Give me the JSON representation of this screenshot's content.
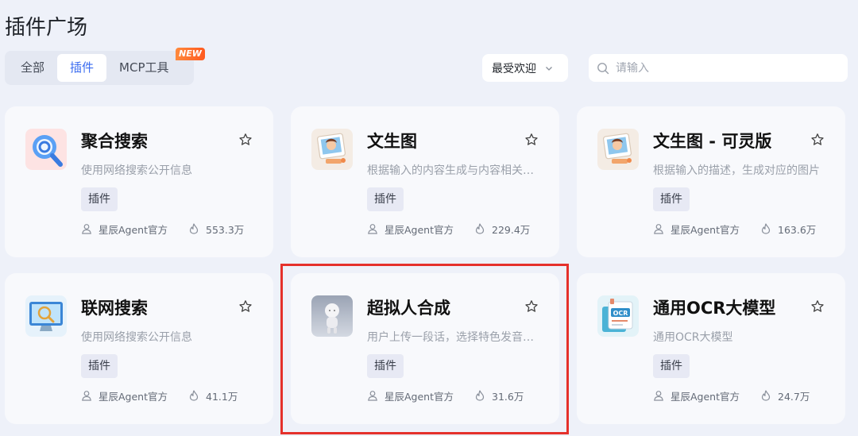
{
  "page": {
    "title": "插件广场"
  },
  "tabs": [
    {
      "label": "全部",
      "active": false
    },
    {
      "label": "插件",
      "active": true
    },
    {
      "label": "MCP工具",
      "active": false,
      "badge": "NEW"
    }
  ],
  "sort": {
    "selected": "最受欢迎"
  },
  "search": {
    "placeholder": "请输入"
  },
  "cards": [
    {
      "title": "聚合搜索",
      "description": "使用网络搜索公开信息",
      "tag": "插件",
      "author": "星辰Agent官方",
      "heat": "553.3万",
      "icon": "magnifier-icon"
    },
    {
      "title": "文生图",
      "description": "根据输入的内容生成与内容相关的图片",
      "tag": "插件",
      "author": "星辰Agent官方",
      "heat": "229.4万",
      "icon": "photo-frame-icon"
    },
    {
      "title": "文生图 - 可灵版",
      "description": "根据输入的描述，生成对应的图片",
      "tag": "插件",
      "author": "星辰Agent官方",
      "heat": "163.6万",
      "icon": "photo-frame-icon"
    },
    {
      "title": "联网搜索",
      "description": "使用网络搜索公开信息",
      "tag": "插件",
      "author": "星辰Agent官方",
      "heat": "41.1万",
      "icon": "monitor-search-icon"
    },
    {
      "title": "超拟人合成",
      "description": "用户上传一段话，选择特色发音人合成语音",
      "tag": "插件",
      "author": "星辰Agent官方",
      "heat": "31.6万",
      "icon": "humanoid-figure-icon"
    },
    {
      "title": "通用OCR大模型",
      "description": "通用OCR大模型",
      "tag": "插件",
      "author": "星辰Agent官方",
      "heat": "24.7万",
      "icon": "ocr-document-icon"
    }
  ],
  "colors": {
    "accent": "#3b6cf0",
    "highlight": "#e5312b",
    "background": "#eef1f9"
  }
}
